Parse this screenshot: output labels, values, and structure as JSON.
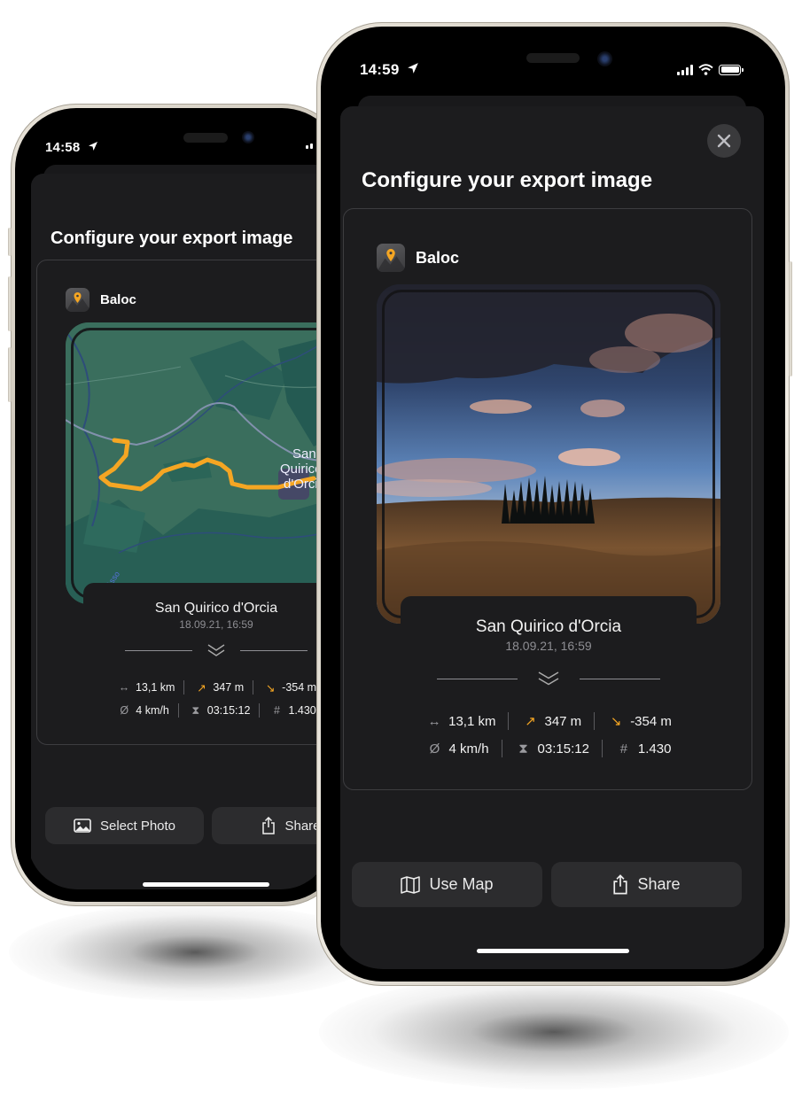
{
  "colors": {
    "background": "#ffffff",
    "screen_bg": "#000000",
    "sheet_bg": "#1c1c1e",
    "button_bg": "#2c2c2e",
    "accent_orange": "#f5a623",
    "map_green": "#356c5b",
    "text_primary": "#ffffff",
    "text_secondary": "#8e8e93"
  },
  "back_phone": {
    "status": {
      "time": "14:58",
      "location_icon": "location-arrow-icon"
    },
    "sheet": {
      "title": "Configure your export image",
      "card": {
        "app_name": "Baloc",
        "app_icon": "map-pin-icon",
        "media_type": "map",
        "map_label": [
          "San",
          "Quirico",
          "d'Orcia"
        ],
        "map_road_label": "Asso",
        "place": "San Quirico d'Orcia",
        "datetime": "18.09.21, 16:59",
        "expand_icon": "double-chevron-down-icon",
        "stats": {
          "row1": [
            {
              "icon": "distance-arrows-icon",
              "glyph": "↔",
              "value": "13,1 km"
            },
            {
              "icon": "ascent-arrow-icon",
              "glyph": "↗",
              "value": "347 m"
            },
            {
              "icon": "descent-arrow-icon",
              "glyph": "↘",
              "value": "-354 m"
            }
          ],
          "row2": [
            {
              "icon": "average-speed-icon",
              "glyph": "Ø",
              "value": "4 km/h"
            },
            {
              "icon": "hourglass-icon",
              "glyph": "⧗",
              "value": "03:15:12"
            },
            {
              "icon": "hash-icon",
              "glyph": "#",
              "value": "1.430"
            }
          ]
        }
      },
      "buttons": {
        "select_photo": "Select Photo",
        "share": "Share"
      }
    }
  },
  "front_phone": {
    "status": {
      "time": "14:59",
      "location_icon": "location-arrow-icon"
    },
    "sheet": {
      "close_icon": "close-icon",
      "title": "Configure your export image",
      "card": {
        "app_name": "Baloc",
        "app_icon": "map-pin-icon",
        "media_type": "photo",
        "photo_subject": "cypress trees on Tuscan hills under a cloudy sky",
        "place": "San Quirico d'Orcia",
        "datetime": "18.09.21, 16:59",
        "expand_icon": "double-chevron-down-icon",
        "stats": {
          "row1": [
            {
              "icon": "distance-arrows-icon",
              "glyph": "↔",
              "value": "13,1 km"
            },
            {
              "icon": "ascent-arrow-icon",
              "glyph": "↗",
              "value": "347 m"
            },
            {
              "icon": "descent-arrow-icon",
              "glyph": "↘",
              "value": "-354 m"
            }
          ],
          "row2": [
            {
              "icon": "average-speed-icon",
              "glyph": "Ø",
              "value": "4 km/h"
            },
            {
              "icon": "hourglass-icon",
              "glyph": "⧗",
              "value": "03:15:12"
            },
            {
              "icon": "hash-icon",
              "glyph": "#",
              "value": "1.430"
            }
          ]
        }
      },
      "buttons": {
        "use_map": "Use Map",
        "share": "Share"
      }
    }
  }
}
